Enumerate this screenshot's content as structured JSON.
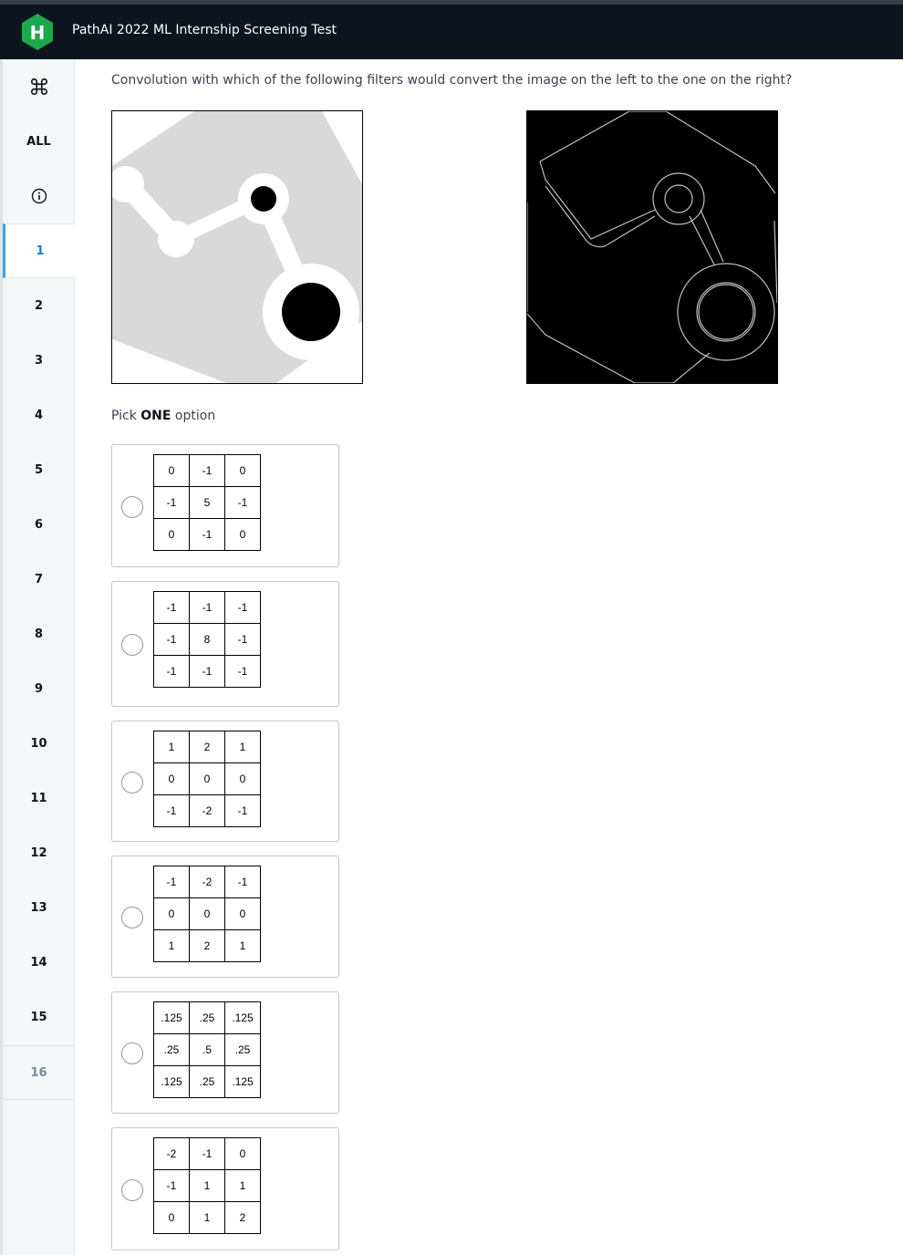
{
  "header": {
    "logo_letter": "H",
    "title": "PathAI 2022 ML Internship Screening Test",
    "brand_color": "#1ba94c"
  },
  "sidebar": {
    "items": [
      {
        "label": "⌘",
        "name": "command-icon"
      },
      {
        "label": "ALL",
        "name": "sidebar-item-all"
      },
      {
        "label": "ⓘ",
        "name": "info-icon"
      },
      {
        "label": "1",
        "name": "sidebar-item-1"
      },
      {
        "label": "2",
        "name": "sidebar-item-2"
      },
      {
        "label": "3",
        "name": "sidebar-item-3"
      },
      {
        "label": "4",
        "name": "sidebar-item-4"
      },
      {
        "label": "5",
        "name": "sidebar-item-5"
      },
      {
        "label": "6",
        "name": "sidebar-item-6"
      },
      {
        "label": "7",
        "name": "sidebar-item-7"
      },
      {
        "label": "8",
        "name": "sidebar-item-8"
      },
      {
        "label": "9",
        "name": "sidebar-item-9"
      },
      {
        "label": "10",
        "name": "sidebar-item-10"
      },
      {
        "label": "11",
        "name": "sidebar-item-11"
      },
      {
        "label": "12",
        "name": "sidebar-item-12"
      },
      {
        "label": "13",
        "name": "sidebar-item-13"
      },
      {
        "label": "14",
        "name": "sidebar-item-14"
      },
      {
        "label": "15",
        "name": "sidebar-item-15"
      },
      {
        "label": "16",
        "name": "sidebar-item-16"
      }
    ],
    "active": "1"
  },
  "question": {
    "text": "Convolution with which of the following filters would convert the image on the left to the one on the right?",
    "pick_prefix": "Pick ",
    "pick_bold": "ONE",
    "pick_suffix": " option"
  },
  "options": [
    {
      "matrix": [
        [
          "0",
          "-1",
          "0"
        ],
        [
          "-1",
          "5",
          "-1"
        ],
        [
          "0",
          "-1",
          "0"
        ]
      ]
    },
    {
      "matrix": [
        [
          "-1",
          "-1",
          "-1"
        ],
        [
          "-1",
          "8",
          "-1"
        ],
        [
          "-1",
          "-1",
          "-1"
        ]
      ]
    },
    {
      "matrix": [
        [
          "1",
          "2",
          "1"
        ],
        [
          "0",
          "0",
          "0"
        ],
        [
          "-1",
          "-2",
          "-1"
        ]
      ]
    },
    {
      "matrix": [
        [
          "-1",
          "-2",
          "-1"
        ],
        [
          "0",
          "0",
          "0"
        ],
        [
          "1",
          "2",
          "1"
        ]
      ]
    },
    {
      "matrix": [
        [
          ".125",
          ".25",
          ".125"
        ],
        [
          ".25",
          ".5",
          ".25"
        ],
        [
          ".125",
          ".25",
          ".125"
        ]
      ]
    },
    {
      "matrix": [
        [
          "-2",
          "-1",
          "0"
        ],
        [
          "-1",
          "1",
          "1"
        ],
        [
          "0",
          "1",
          "2"
        ]
      ]
    }
  ]
}
